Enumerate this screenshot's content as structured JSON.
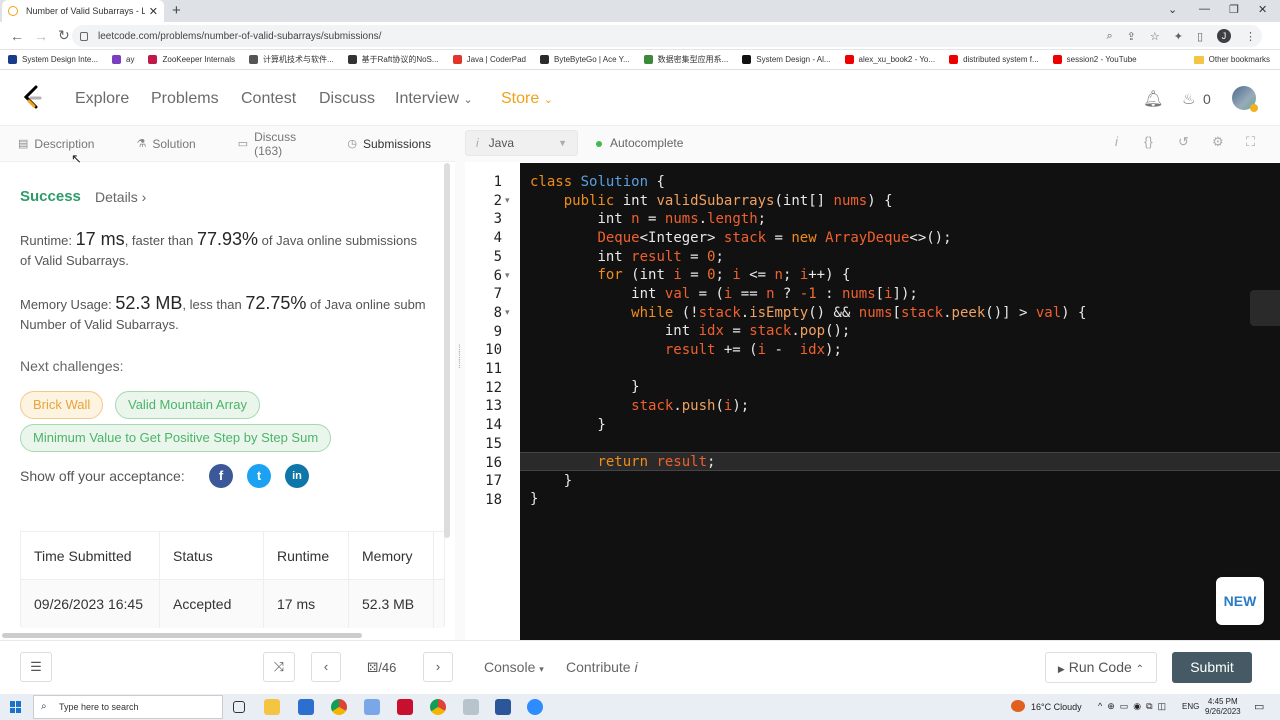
{
  "browser": {
    "tab_title": "Number of Valid Subarrays - Lee",
    "url": "leetcode.com/problems/number-of-valid-subarrays/submissions/",
    "profile_initial": "J",
    "bookmarks": [
      "System Design Inte...",
      "ay",
      "ZooKeeper Internals",
      "计算机技术与软件...",
      "基于Raft协议的NoS...",
      "Java | CoderPad",
      "ByteByteGo | Ace Y...",
      "数据密集型应用系...",
      "System Design - Al...",
      "alex_xu_book2 - Yo...",
      "distributed system f...",
      "session2 - YouTube"
    ],
    "other_bookmarks": "Other bookmarks"
  },
  "nav": {
    "explore": "Explore",
    "problems": "Problems",
    "contest": "Contest",
    "discuss": "Discuss",
    "interview": "Interview",
    "store": "Store",
    "fire_count": "0"
  },
  "left_tabs": {
    "description": "Description",
    "solution": "Solution",
    "discuss": "Discuss (163)",
    "submissions": "Submissions"
  },
  "result": {
    "status": "Success",
    "details": "Details",
    "runtime_label": "Runtime:",
    "runtime_value": "17 ms",
    "runtime_mid": ", faster than",
    "runtime_pct": "77.93%",
    "runtime_tail": "of Java online submissions",
    "runtime_line2": "of Valid Subarrays.",
    "memory_label": "Memory Usage:",
    "memory_value": "52.3 MB",
    "memory_mid": ", less than",
    "memory_pct": "72.75%",
    "memory_tail": "of Java online subm",
    "memory_line2": "Number of Valid Subarrays.",
    "next_challenges": "Next challenges:",
    "challenges": [
      "Brick Wall",
      "Valid Mountain Array",
      "Minimum Value to Get Positive Step by Step Sum"
    ],
    "show_off": "Show off your acceptance:"
  },
  "submission_table": {
    "headers": [
      "Time Submitted",
      "Status",
      "Runtime",
      "Memory"
    ],
    "row": [
      "09/26/2023 16:45",
      "Accepted",
      "17 ms",
      "52.3 MB"
    ]
  },
  "editor": {
    "language": "Java",
    "autocomplete": "Autocomplete",
    "line_numbers": [
      "1",
      "2",
      "3",
      "4",
      "5",
      "6",
      "7",
      "8",
      "9",
      "10",
      "11",
      "12",
      "13",
      "14",
      "15",
      "16",
      "17",
      "18"
    ],
    "new_badge": "NEW"
  },
  "bottom": {
    "page": "/46",
    "console": "Console",
    "contribute": "Contribute",
    "run_code": "Run Code",
    "submit": "Submit"
  },
  "taskbar": {
    "search_placeholder": "Type here to search",
    "weather": "16°C  Cloudy",
    "lang": "ENG",
    "time": "4:45 PM",
    "date": "9/26/2023"
  },
  "colors": {
    "accent_green": "#2e9c6a",
    "store_orange": "#f0a21a",
    "submit_bg": "#455a64",
    "editor_bg": "#111111"
  }
}
